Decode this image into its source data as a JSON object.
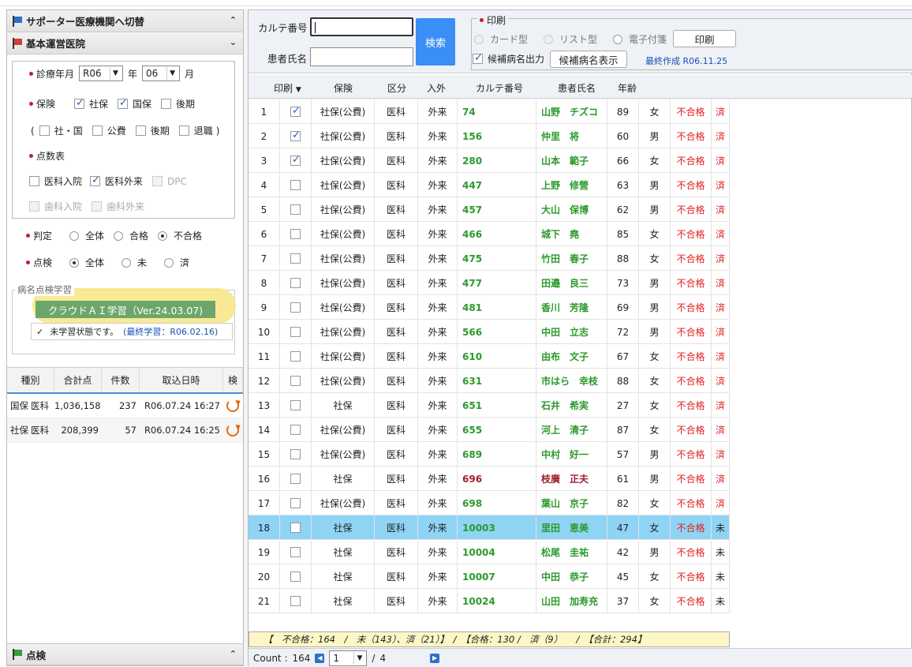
{
  "left": {
    "header_supporter": "サポーター医療機関へ切替",
    "header_hospital": "基本運営医院",
    "shinryo_label": "診療年月",
    "year_value": "R06",
    "year_suffix": "年",
    "month_value": "06",
    "month_suffix": "月",
    "hoken_label": "保険",
    "hoken_opts": [
      "社保",
      "国保",
      "後期"
    ],
    "paren_open": "(",
    "paren_close": ")",
    "sub_opts": [
      "社・国",
      "公費",
      "後期",
      "退職"
    ],
    "tensu_label": "点数表",
    "tensu_opts": [
      "医科入院",
      "医科外来",
      "DPC",
      "歯科入院",
      "歯科外来"
    ],
    "hantei_label": "判定",
    "hantei_opts": [
      "全体",
      "合格",
      "不合格"
    ],
    "tenken_label": "点検",
    "tenken_opts": [
      "全体",
      "未",
      "済"
    ],
    "learn_legend": "病名点検学習",
    "learn_button": "クラウドＡＩ学習（Ver.24.03.07)",
    "learn_status": "未学習状態です。",
    "learn_date": "(最終学習：R06.02.16)",
    "hist_headers": [
      "種別",
      "合計点",
      "件数",
      "取込日時",
      "検"
    ],
    "hist_rows": [
      {
        "a": "国保",
        "b": "医科",
        "total": "1,036,158",
        "count": "237",
        "dt": "R06.07.24 16:27"
      },
      {
        "a": "社保",
        "b": "医科",
        "total": "208,399",
        "count": "57",
        "dt": "R06.07.24 16:25"
      }
    ],
    "bottom_header": "点検"
  },
  "right": {
    "karte_label": "カルテ番号",
    "patient_label": "患者氏名",
    "search_button": "検索",
    "print_legend": "印刷",
    "radio_card": "カード型",
    "radio_list": "リスト型",
    "radio_label": "電子付箋",
    "print_button": "印刷",
    "kouho_label": "候補病名出力",
    "kouho_button": "候補病名表示",
    "last_created": "最終作成 R06.11.25",
    "headers": [
      "印刷",
      "保険",
      "区分",
      "入外",
      "カルテ番号",
      "患者氏名",
      "年齢"
    ],
    "rows": [
      {
        "n": "1",
        "chk": true,
        "ins": "社保(公費)",
        "k": "医科",
        "io": "外来",
        "id": "74",
        "name": "山野　チズコ",
        "age": "89",
        "sex": "女",
        "res": "不合格",
        "st": "済"
      },
      {
        "n": "2",
        "chk": true,
        "ins": "社保(公費)",
        "k": "医科",
        "io": "外来",
        "id": "156",
        "name": "仲里　将",
        "age": "60",
        "sex": "男",
        "res": "不合格",
        "st": "済"
      },
      {
        "n": "3",
        "chk": true,
        "ins": "社保(公費)",
        "k": "医科",
        "io": "外来",
        "id": "280",
        "name": "山本　範子",
        "age": "66",
        "sex": "女",
        "res": "不合格",
        "st": "済"
      },
      {
        "n": "4",
        "chk": false,
        "ins": "社保(公費)",
        "k": "医科",
        "io": "外来",
        "id": "447",
        "name": "上野　修營",
        "age": "63",
        "sex": "男",
        "res": "不合格",
        "st": "済"
      },
      {
        "n": "5",
        "chk": false,
        "ins": "社保(公費)",
        "k": "医科",
        "io": "外来",
        "id": "457",
        "name": "大山　保博",
        "age": "62",
        "sex": "男",
        "res": "不合格",
        "st": "済"
      },
      {
        "n": "6",
        "chk": false,
        "ins": "社保(公費)",
        "k": "医科",
        "io": "外来",
        "id": "466",
        "name": "城下　堯",
        "age": "85",
        "sex": "女",
        "res": "不合格",
        "st": "済"
      },
      {
        "n": "7",
        "chk": false,
        "ins": "社保(公費)",
        "k": "医科",
        "io": "外来",
        "id": "475",
        "name": "竹田　春子",
        "age": "88",
        "sex": "女",
        "res": "不合格",
        "st": "済"
      },
      {
        "n": "8",
        "chk": false,
        "ins": "社保(公費)",
        "k": "医科",
        "io": "外来",
        "id": "477",
        "name": "田邉　良三",
        "age": "73",
        "sex": "男",
        "res": "不合格",
        "st": "済"
      },
      {
        "n": "9",
        "chk": false,
        "ins": "社保(公費)",
        "k": "医科",
        "io": "外来",
        "id": "481",
        "name": "香川　芳隆",
        "age": "69",
        "sex": "男",
        "res": "不合格",
        "st": "済"
      },
      {
        "n": "10",
        "chk": false,
        "ins": "社保(公費)",
        "k": "医科",
        "io": "外来",
        "id": "566",
        "name": "中田　立志",
        "age": "72",
        "sex": "男",
        "res": "不合格",
        "st": "済"
      },
      {
        "n": "11",
        "chk": false,
        "ins": "社保(公費)",
        "k": "医科",
        "io": "外来",
        "id": "610",
        "name": "由布　文子",
        "age": "67",
        "sex": "女",
        "res": "不合格",
        "st": "済"
      },
      {
        "n": "12",
        "chk": false,
        "ins": "社保(公費)",
        "k": "医科",
        "io": "外来",
        "id": "631",
        "name": "市はら　幸枝",
        "age": "88",
        "sex": "女",
        "res": "不合格",
        "st": "済"
      },
      {
        "n": "13",
        "chk": false,
        "ins": "社保",
        "k": "医科",
        "io": "外来",
        "id": "651",
        "name": "石井　希実",
        "age": "27",
        "sex": "女",
        "res": "不合格",
        "st": "済"
      },
      {
        "n": "14",
        "chk": false,
        "ins": "社保(公費)",
        "k": "医科",
        "io": "外来",
        "id": "655",
        "name": "河上　清子",
        "age": "87",
        "sex": "女",
        "res": "不合格",
        "st": "済"
      },
      {
        "n": "15",
        "chk": false,
        "ins": "社保(公費)",
        "k": "医科",
        "io": "外来",
        "id": "689",
        "name": "中村　好一",
        "age": "57",
        "sex": "男",
        "res": "不合格",
        "st": "済"
      },
      {
        "n": "16",
        "chk": false,
        "ins": "社保",
        "k": "医科",
        "io": "外来",
        "id": "696",
        "name": "枝廣　正夫",
        "age": "61",
        "sex": "男",
        "res": "不合格",
        "st": "済",
        "maroon": true
      },
      {
        "n": "17",
        "chk": false,
        "ins": "社保(公費)",
        "k": "医科",
        "io": "外来",
        "id": "698",
        "name": "葉山　京子",
        "age": "82",
        "sex": "女",
        "res": "不合格",
        "st": "済"
      },
      {
        "n": "18",
        "chk": false,
        "ins": "社保",
        "k": "医科",
        "io": "外来",
        "id": "10003",
        "name": "里田　恵美",
        "age": "47",
        "sex": "女",
        "res": "不合格",
        "st": "未",
        "selected": true
      },
      {
        "n": "19",
        "chk": false,
        "ins": "社保",
        "k": "医科",
        "io": "外来",
        "id": "10004",
        "name": "松尾　圭祐",
        "age": "42",
        "sex": "男",
        "res": "不合格",
        "st": "未"
      },
      {
        "n": "20",
        "chk": false,
        "ins": "社保",
        "k": "医科",
        "io": "外来",
        "id": "10007",
        "name": "中田　恭子",
        "age": "45",
        "sex": "女",
        "res": "不合格",
        "st": "未"
      },
      {
        "n": "21",
        "chk": false,
        "ins": "社保",
        "k": "医科",
        "io": "外来",
        "id": "10024",
        "name": "山田　加寿充",
        "age": "37",
        "sex": "女",
        "res": "不合格",
        "st": "未"
      }
    ],
    "summary": "【　不合格：164　/　未（143）、済（21）】　/　【合格：130 /　済（9）　　/　【合計：294】",
    "count_label": "Count :",
    "count_value": "164",
    "page_value": "1",
    "page_sep": "/",
    "page_total": "4"
  }
}
